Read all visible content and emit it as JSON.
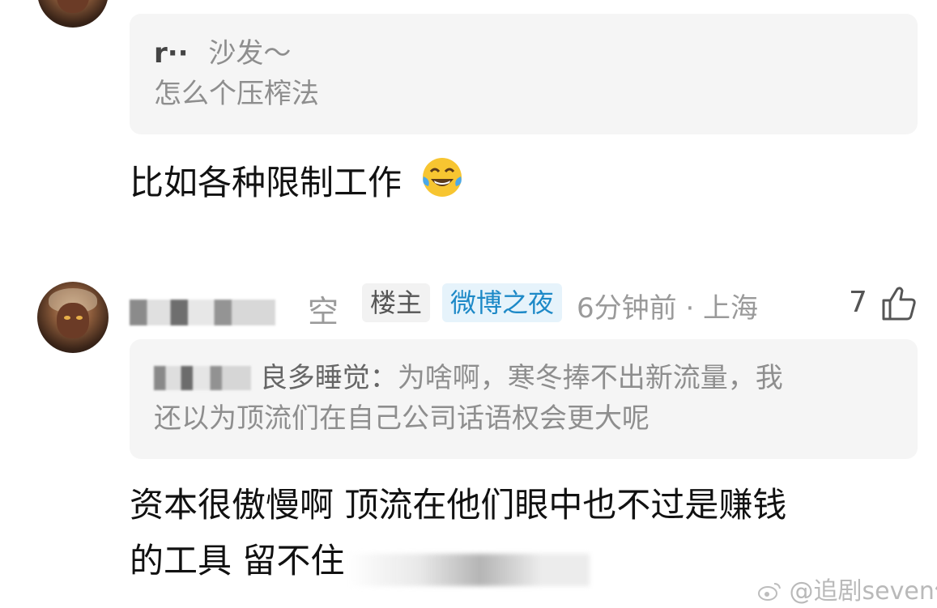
{
  "post_1": {
    "quote_author": "r··",
    "quote_line_1": "沙发～",
    "quote_line_2": "怎么个压榨法",
    "comment": "比如各种限制工作"
  },
  "post_2": {
    "username_suffix": "空",
    "badge_owner": "楼主",
    "badge_event": "微博之夜",
    "meta": "6分钟前 · 上海",
    "likes": "7",
    "quote_author_suffix": "良多睡觉：",
    "quote_line_1": "为啥啊，寒冬捧不出新流量，我",
    "quote_line_2": "还以为顶流们在自己公司话语权会更大呢",
    "comment_line_1": "资本很傲慢啊 顶流在他们眼中也不过是赚钱",
    "comment_line_2": "的工具 留不住"
  },
  "watermark": {
    "text": "@追剧seven仙女"
  },
  "icons": {
    "emoji": "laughing-tears-emoji",
    "like": "thumbs-up-icon",
    "weibo": "weibo-logo-icon"
  },
  "colors": {
    "quote_bg": "#f5f5f5",
    "event_badge_bg": "#e6f3fb",
    "event_badge_text": "#1d89c7",
    "muted_text": "#8e8e8e"
  }
}
